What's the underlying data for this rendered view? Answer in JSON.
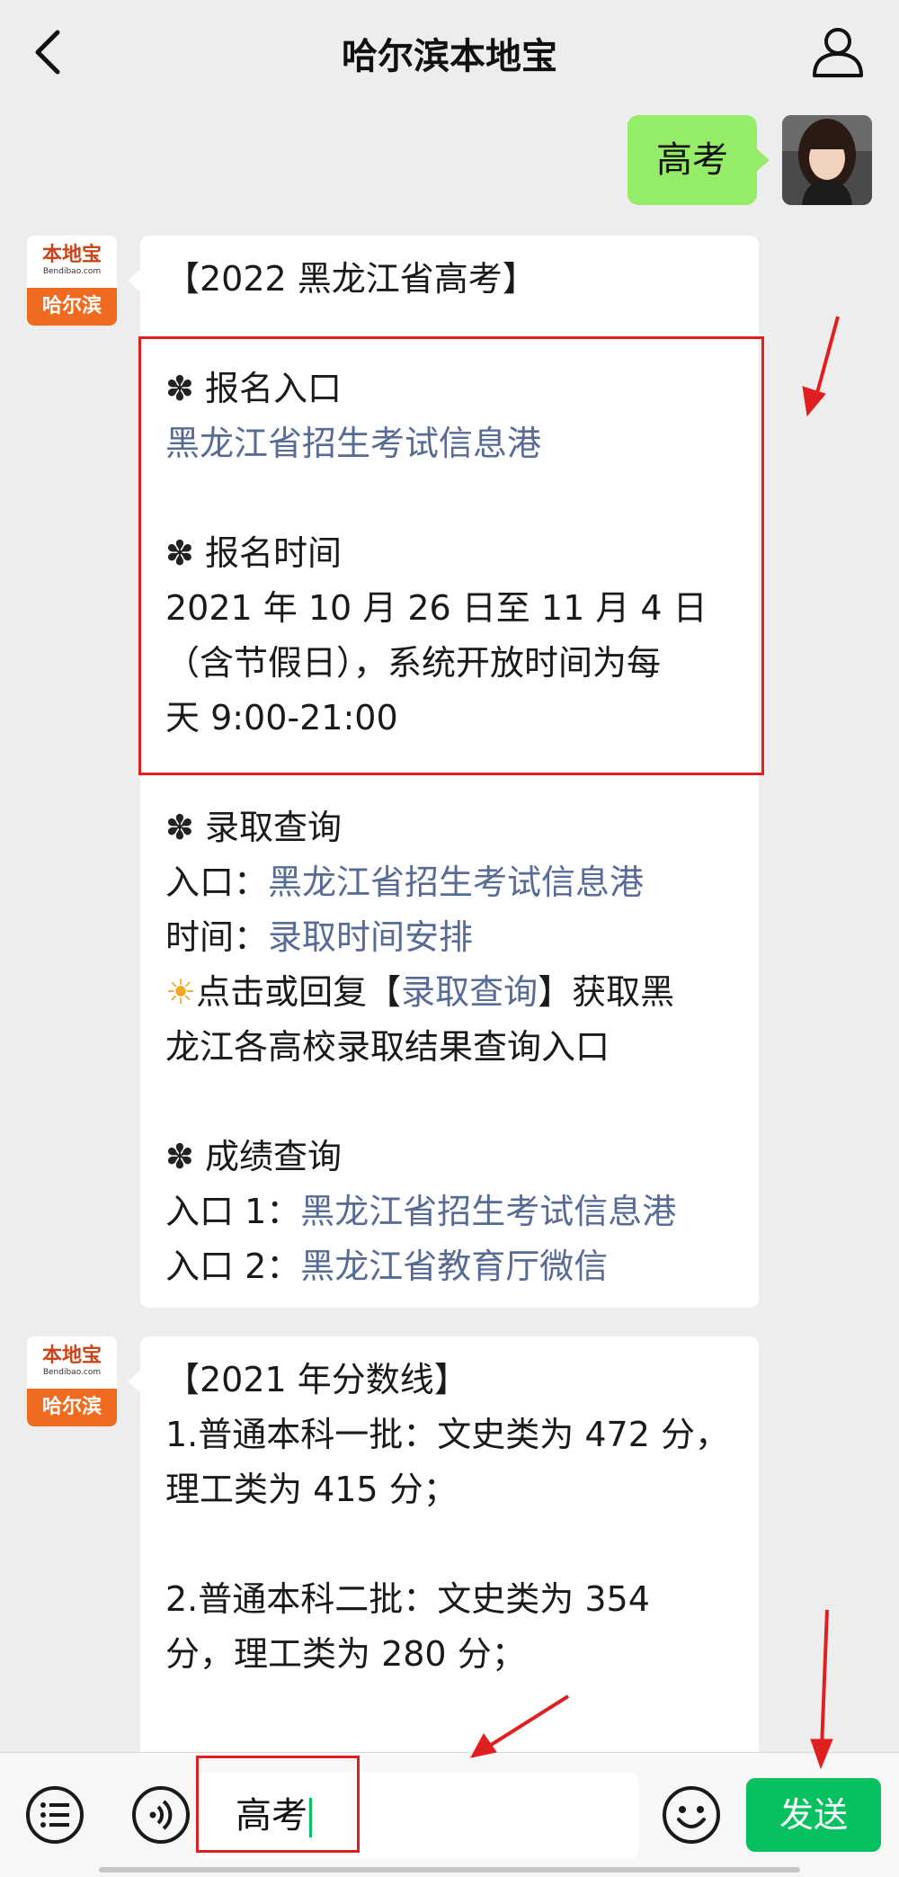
{
  "header": {
    "title": "哈尔滨本地宝"
  },
  "chat": {
    "sent_message": "高考",
    "bot": {
      "avatar_brand": "本地宝",
      "avatar_domain": "Bendibao.com",
      "avatar_city": "哈尔滨"
    },
    "message1": {
      "title": "【2022 黑龙江省高考】",
      "signup_heading": "报名入口",
      "signup_link": "黑龙江省招生考试信息港",
      "time_heading": "报名时间",
      "time_line1": "2021 年 10 月 26 日至 11 月 4 日",
      "time_line2": "（含节假日），系统开放时间为每",
      "time_line3": "天 9:00-21:00",
      "admission_heading": "录取查询",
      "admission_entry_label": "入口：",
      "admission_entry_link": "黑龙江省招生考试信息港",
      "admission_time_label": "时间：",
      "admission_time_link": "录取时间安排",
      "tip_prefix": "点击或回复【",
      "tip_link": "录取查询",
      "tip_suffix": "】获取黑",
      "tip_line2": "龙江各高校录取结果查询入口",
      "score_heading": "成绩查询",
      "score_entry1_label": "入口 1：",
      "score_entry1_link": "黑龙江省招生考试信息港",
      "score_entry2_label": "入口 2：",
      "score_entry2_link": "黑龙江省教育厅微信"
    },
    "message2": {
      "title": "【2021 年分数线】",
      "line1": "1.普通本科一批：文史类为 472 分，",
      "line2": "理工类为 415 分；",
      "line3": "2.普通本科二批：文史类为 354",
      "line4": "分，理工类为 280 分；"
    }
  },
  "input_bar": {
    "input_value": "高考",
    "send_label": "发送"
  },
  "icons": {
    "flower": "✽",
    "sun": "☀",
    "back": "chevron-left-icon",
    "profile": "person-icon",
    "menu": "list-menu-icon",
    "voice": "voice-icon",
    "emoji": "emoji-icon"
  },
  "colors": {
    "send_button": "#07c160",
    "sent_bubble": "#95ec69",
    "link": "#576b95",
    "highlight": "#e02020"
  }
}
